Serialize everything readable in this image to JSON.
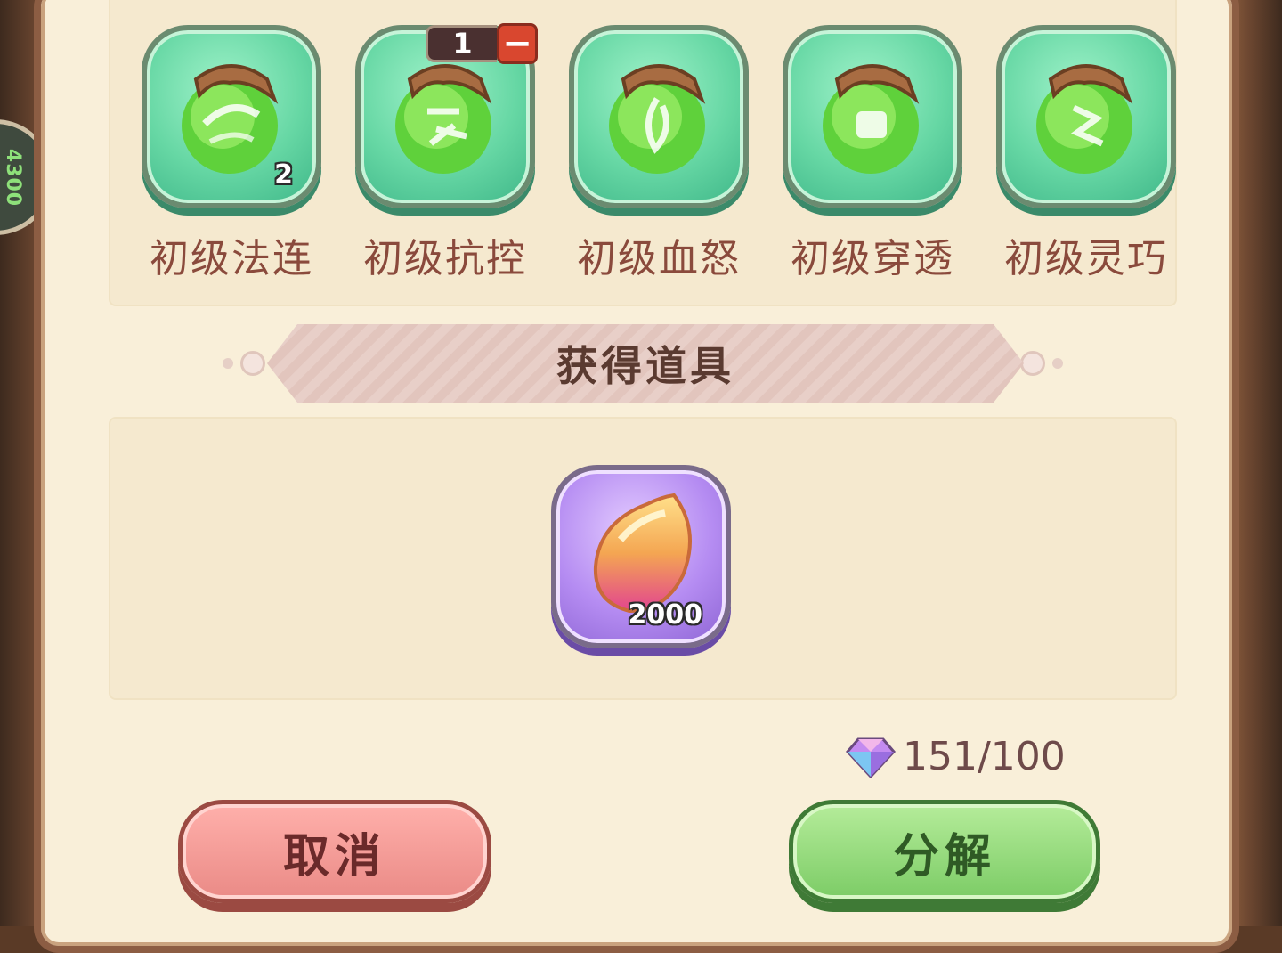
{
  "side": {
    "badge_text": "4300"
  },
  "materials": [
    {
      "label": "初级法连",
      "count": "2"
    },
    {
      "label": "初级抗控",
      "count": ""
    },
    {
      "label": "初级血怒",
      "count": ""
    },
    {
      "label": "初级穿透",
      "count": ""
    },
    {
      "label": "初级灵巧",
      "count": ""
    }
  ],
  "selection": {
    "quantity": "1",
    "minus_symbol": "−"
  },
  "section": {
    "title": "获得道具"
  },
  "reward": {
    "count": "2000"
  },
  "currency": {
    "value": "151/100"
  },
  "buttons": {
    "cancel": "取消",
    "decompose": "分解"
  },
  "colors": {
    "accent_green": "#7ccc66",
    "accent_red": "#ea8a86",
    "panel_bg": "#f9efd9",
    "text_brown": "#8a4a3c"
  }
}
